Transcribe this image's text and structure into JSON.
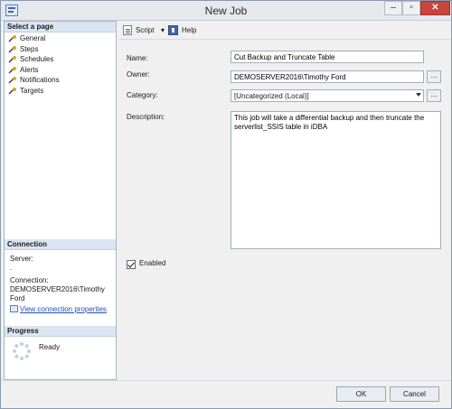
{
  "window": {
    "title": "New Job"
  },
  "sidebar": {
    "select_page_header": "Select a page",
    "pages": [
      {
        "label": "General"
      },
      {
        "label": "Steps"
      },
      {
        "label": "Schedules"
      },
      {
        "label": "Alerts"
      },
      {
        "label": "Notifications"
      },
      {
        "label": "Targets"
      }
    ],
    "connection": {
      "header": "Connection",
      "server_label": "Server:",
      "server_value": ".",
      "connection_label": "Connection:",
      "connection_value": "DEMOSERVER2016\\Timothy Ford",
      "view_properties_link": "View connection properties"
    },
    "progress": {
      "header": "Progress",
      "status": "Ready"
    }
  },
  "toolbar": {
    "script_label": "Script",
    "help_label": "Help"
  },
  "form": {
    "name_label": "Name:",
    "name_value": "Cut Backup and Truncate Table",
    "owner_label": "Owner:",
    "owner_value": "DEMOSERVER2016\\Timothy Ford",
    "owner_browse": "...",
    "category_label": "Category:",
    "category_value": "[Uncategorized (Local)]",
    "category_browse": "...",
    "description_label": "Description:",
    "description_value": "This job will take a differential backup and then truncate the serverlist_SSIS table in iDBA",
    "enabled_label": "Enabled",
    "enabled_checked": true
  },
  "footer": {
    "ok_label": "OK",
    "cancel_label": "Cancel"
  }
}
